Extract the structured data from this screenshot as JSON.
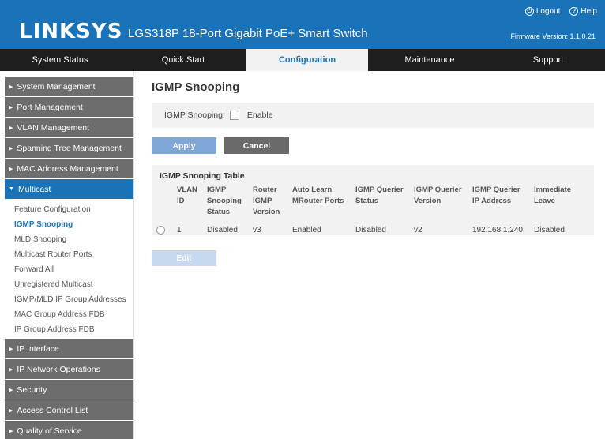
{
  "header": {
    "brand": "LINKSYS",
    "product": "LGS318P 18-Port Gigabit PoE+ Smart Switch",
    "logout": "Logout",
    "help": "Help",
    "firmware": "Firmware Version: 1.1.0.21"
  },
  "nav": [
    {
      "label": "System Status"
    },
    {
      "label": "Quick Start"
    },
    {
      "label": "Configuration"
    },
    {
      "label": "Maintenance"
    },
    {
      "label": "Support"
    }
  ],
  "sidebar": {
    "top_items": [
      {
        "label": "System Management"
      },
      {
        "label": "Port Management"
      },
      {
        "label": "VLAN Management"
      },
      {
        "label": "Spanning Tree Management"
      },
      {
        "label": "MAC Address Management"
      },
      {
        "label": "Multicast"
      }
    ],
    "sub_items": [
      {
        "label": "Feature Configuration"
      },
      {
        "label": "IGMP Snooping"
      },
      {
        "label": "MLD Snooping"
      },
      {
        "label": "Multicast Router Ports"
      },
      {
        "label": "Forward All"
      },
      {
        "label": "Unregistered Multicast"
      },
      {
        "label": "IGMP/MLD IP Group Addresses"
      },
      {
        "label": "MAC Group Address FDB"
      },
      {
        "label": "IP Group Address FDB"
      }
    ],
    "bottom_items": [
      {
        "label": "IP Interface"
      },
      {
        "label": "IP Network Operations"
      },
      {
        "label": "Security"
      },
      {
        "label": "Access Control List"
      },
      {
        "label": "Quality of Service"
      }
    ]
  },
  "main": {
    "title": "IGMP Snooping",
    "setting_label": "IGMP Snooping:",
    "enable_label": "Enable",
    "apply": "Apply",
    "cancel": "Cancel",
    "table_title": "IGMP Snooping Table",
    "columns": [
      [
        "VLAN",
        "ID"
      ],
      [
        "IGMP",
        "Snooping",
        "Status"
      ],
      [
        "Router",
        "IGMP",
        "Version"
      ],
      [
        "Auto Learn",
        "MRouter Ports"
      ],
      [
        "IGMP Querier",
        "Status"
      ],
      [
        "IGMP Querier",
        "Version"
      ],
      [
        "IGMP Querier",
        "IP Address"
      ],
      [
        "Immediate",
        "Leave"
      ]
    ],
    "rows": [
      [
        "1",
        "Disabled",
        "v3",
        "Enabled",
        "Disabled",
        "v2",
        "192.168.1.240",
        "Disabled"
      ]
    ],
    "edit": "Edit"
  },
  "colors": {
    "brand_blue": "#1a73b8",
    "nav_dark": "#1e1e1e",
    "sidebar_gray": "#6d6d6d"
  }
}
